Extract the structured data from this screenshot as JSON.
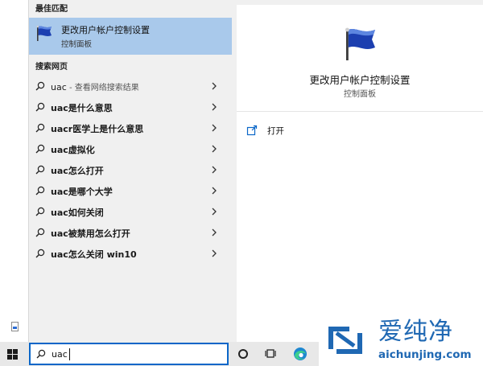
{
  "results": {
    "best_match_header": "最佳匹配",
    "best_match": {
      "title": "更改用户帐户控制设置",
      "subtitle": "控制面板",
      "icon": "flag-icon"
    },
    "web_header": "搜索网页",
    "web_items": [
      {
        "query": "uac",
        "suffix": " - 查看网络搜索结果"
      },
      {
        "query": "uac是什么意思",
        "suffix": ""
      },
      {
        "query": "uacr医学上是什么意思",
        "suffix": ""
      },
      {
        "query": "uac虚拟化",
        "suffix": ""
      },
      {
        "query": "uac怎么打开",
        "suffix": ""
      },
      {
        "query": "uac是哪个大学",
        "suffix": ""
      },
      {
        "query": "uac如何关闭",
        "suffix": ""
      },
      {
        "query": "uac被禁用怎么打开",
        "suffix": ""
      },
      {
        "query": "uac怎么关闭 win10",
        "suffix": ""
      }
    ]
  },
  "preview": {
    "title": "更改用户帐户控制设置",
    "subtitle": "控制面板",
    "actions": [
      {
        "label": "打开",
        "icon": "open-icon"
      }
    ]
  },
  "taskbar": {
    "search_value": "uac"
  },
  "watermark": {
    "cn": "爱纯净",
    "en": "aichunjing.com"
  },
  "colors": {
    "selection": "#a9c9eb",
    "pane": "#f0f0f0",
    "search_border": "#0a66c8",
    "watermark": "#1f68b3"
  }
}
